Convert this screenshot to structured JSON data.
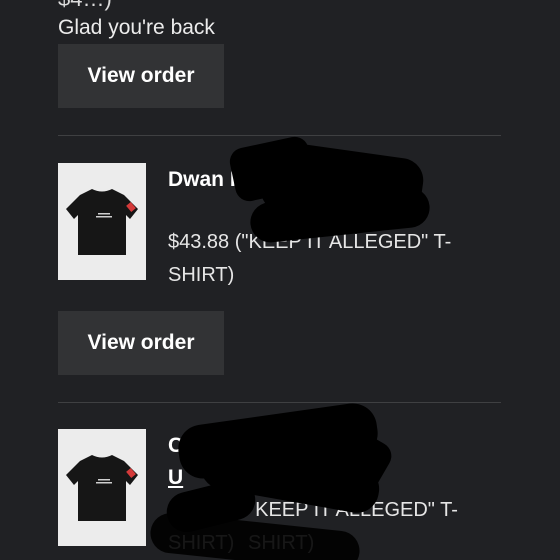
{
  "top_fragment": "$4…)",
  "greeting": "Glad you're back",
  "orders": [
    {
      "view_label": "View order",
      "customer": "Dwan I",
      "product": "$43.88 (\"KEEP IT ALLEGED\" T-SHIRT)"
    },
    {
      "view_label": "View order",
      "customer": "C W",
      "product": "\"KEEP IT ALLEGED\" T-SHIRT)",
      "product_prefix": "$",
      "customer_line2": "U"
    }
  ],
  "icons": {
    "shirt": "t-shirt-product-image"
  },
  "colors": {
    "background": "#202124",
    "button": "#323335",
    "divider": "#3f4042",
    "thumbnail_bg": "#ececec",
    "shirt": "#161616",
    "sleeve_patch": "#d43a3a"
  }
}
